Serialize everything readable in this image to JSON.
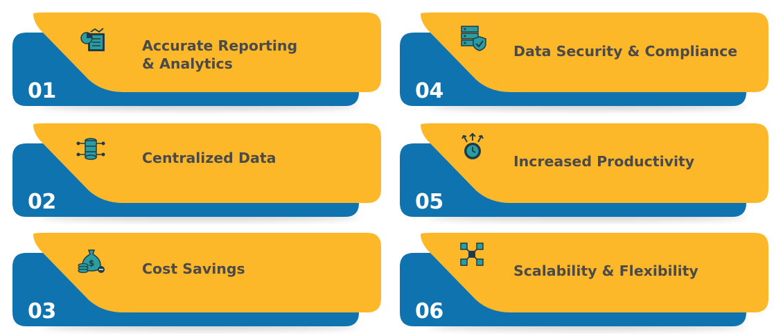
{
  "colors": {
    "yellow": "#FDB82A",
    "blue": "#0E73AE",
    "blue_dark": "#0A5C8F",
    "text": "#4A4A4A",
    "icon_teal": "#1F8E94",
    "icon_dark": "#1F3A4A"
  },
  "items": [
    {
      "number": "01",
      "label": "Accurate Reporting\n& Analytics",
      "icon": "report-analytics-icon"
    },
    {
      "number": "02",
      "label": "Centralized Data",
      "icon": "database-network-icon"
    },
    {
      "number": "03",
      "label": "Cost Savings",
      "icon": "money-bag-coins-icon"
    },
    {
      "number": "04",
      "label": "Data Security & Compliance",
      "icon": "server-shield-icon"
    },
    {
      "number": "05",
      "label": "Increased Productivity",
      "icon": "clock-gear-arrows-icon"
    },
    {
      "number": "06",
      "label": "Scalability & Flexibility",
      "icon": "scale-expand-icon"
    }
  ]
}
